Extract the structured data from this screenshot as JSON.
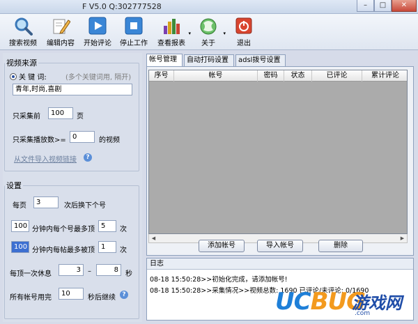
{
  "window": {
    "title": "F V5.0  Q:302777528",
    "controls": [
      "–",
      "□",
      "✕"
    ]
  },
  "toolbar": [
    {
      "label": "搜索视频",
      "icon": "magnifier-icon"
    },
    {
      "label": "编辑内容",
      "icon": "edit-pencil-icon"
    },
    {
      "label": "开始评论",
      "icon": "play-icon"
    },
    {
      "label": "停止工作",
      "icon": "stop-icon"
    },
    {
      "label": "查看报表",
      "icon": "report-chart-icon",
      "dropdown": "▾"
    },
    {
      "label": "关于",
      "icon": "about-globe-icon",
      "dropdown": "▾"
    },
    {
      "label": "退出",
      "icon": "exit-power-icon"
    }
  ],
  "video_source": {
    "legend": "视频来源",
    "keyword_label": "关 键 词:",
    "keyword_hint": "(多个关键词用, 隔开)",
    "keyword_value": "青年,时尚,喜剧",
    "collect_prefix": "只采集前",
    "collect_value": "100",
    "collect_suffix": "页",
    "views_prefix": "只采集播放数>=",
    "views_value": "0",
    "views_suffix": "的视频",
    "import_link": "从文件导入视频链接",
    "help": "?"
  },
  "settings": {
    "legend": "设置",
    "per_page_prefix": "每页",
    "per_page_value": "3",
    "per_page_suffix": "次后换下个号",
    "per_min_value": "100",
    "per_min_text": "分钟内每个号最多顶",
    "per_min_max": "5",
    "per_min_unit": "次",
    "per_post_value": "100",
    "per_post_text": "分钟内每帖最多被顶",
    "per_post_max": "1",
    "per_post_unit": "次",
    "rest_prefix": "每顶一次休息",
    "rest_min": "3",
    "rest_dash": "–",
    "rest_max": "8",
    "rest_unit": "秒",
    "done_prefix": "所有帐号用完",
    "done_value": "10",
    "done_suffix": "秒后继续",
    "help": "?"
  },
  "tabs": [
    "帐号管理",
    "自动打码设置",
    "adsl拨号设置"
  ],
  "grid": {
    "columns": [
      "序号",
      "帐号",
      "密码",
      "状态",
      "已评论",
      "累计评论"
    ]
  },
  "scroll": {
    "left": "◀",
    "right": "▶"
  },
  "buttons": {
    "add": "添加帐号",
    "import": "导入帐号",
    "delete": "删除"
  },
  "log": {
    "title": "日志",
    "lines": [
      "08-18 15:50:28>>初始化完成，请添加帐号!",
      "08-18 15:50:28>>采集情况>>视频总数: 1690 已评论/未评论: 0/1690"
    ]
  },
  "watermark": {
    "brand_a": "UC",
    "brand_b": "BUG",
    "cn": "游戏网",
    "url": ".com"
  }
}
